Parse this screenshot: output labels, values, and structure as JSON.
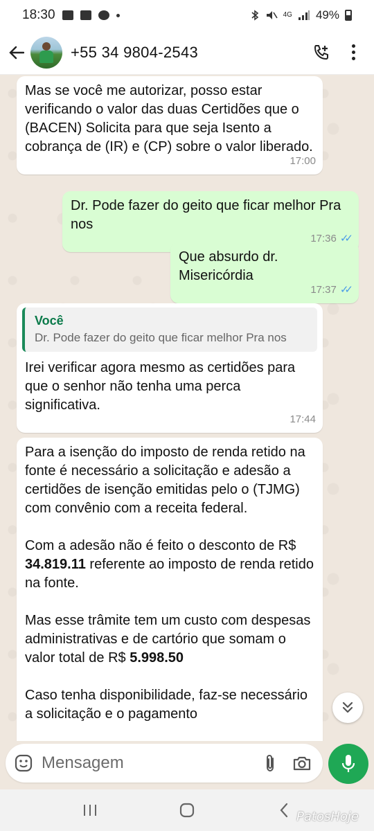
{
  "status_bar": {
    "time": "18:30",
    "network": "4G",
    "battery": "49%"
  },
  "header": {
    "contact_name": "+55 34 9804-2543"
  },
  "messages": [
    {
      "direction": "in",
      "text": "Mas se você me autorizar, posso estar verificando o valor das duas Certidões que o (BACEN) Solicita para que seja Isento a cobrança de (IR) e (CP) sobre o valor liberado.",
      "time": "17:00"
    },
    {
      "direction": "out",
      "text": "Dr. Pode fazer do geito que ficar melhor Pra nos",
      "time": "17:36",
      "ticks": "✓✓"
    },
    {
      "direction": "out",
      "text": "Que absurdo dr. Misericórdia",
      "time": "17:37",
      "ticks": "✓✓"
    },
    {
      "direction": "in",
      "quote": {
        "author": "Você",
        "text": "Dr. Pode fazer do geito que ficar melhor Pra nos"
      },
      "text": "Irei verificar agora mesmo as certidões para que o senhor não tenha uma perca significativa.",
      "time": "17:44"
    },
    {
      "direction": "in",
      "p1": "Para a isenção do imposto de renda retido na fonte é necessário a solicitação e adesão a certidões de isenção emitidas pelo o (TJMG) com convênio com a receita federal.",
      "p2_a": "Com a adesão não é feito o desconto de R$ ",
      "p2_amount": "34.819.11",
      "p2_b": " referente ao imposto de renda retido na fonte.",
      "p3_a": "Mas esse trâmite tem um custo com despesas administrativas e de cartório que somam o valor total de R$ ",
      "p3_amount": "5.998.50",
      "p4": "Caso tenha disponibilidade, faz-se necessário a solicitação e o pagamento"
    }
  ],
  "composer": {
    "placeholder": "Mensagem"
  },
  "watermark": "PatosHoje",
  "icons": {
    "back": "arrow-left-icon",
    "call": "add-call-icon",
    "menu": "more-vert-icon",
    "emoji": "sticker-icon",
    "attach": "paperclip-icon",
    "camera": "camera-icon",
    "mic": "mic-icon",
    "scroll": "double-chevron-down-icon"
  },
  "colors": {
    "incoming_bubble": "#ffffff",
    "outgoing_bubble": "#d9fdd3",
    "accent_green": "#1fa855",
    "read_ticks": "#4a9be8",
    "quote_author": "#0b7a4a"
  }
}
